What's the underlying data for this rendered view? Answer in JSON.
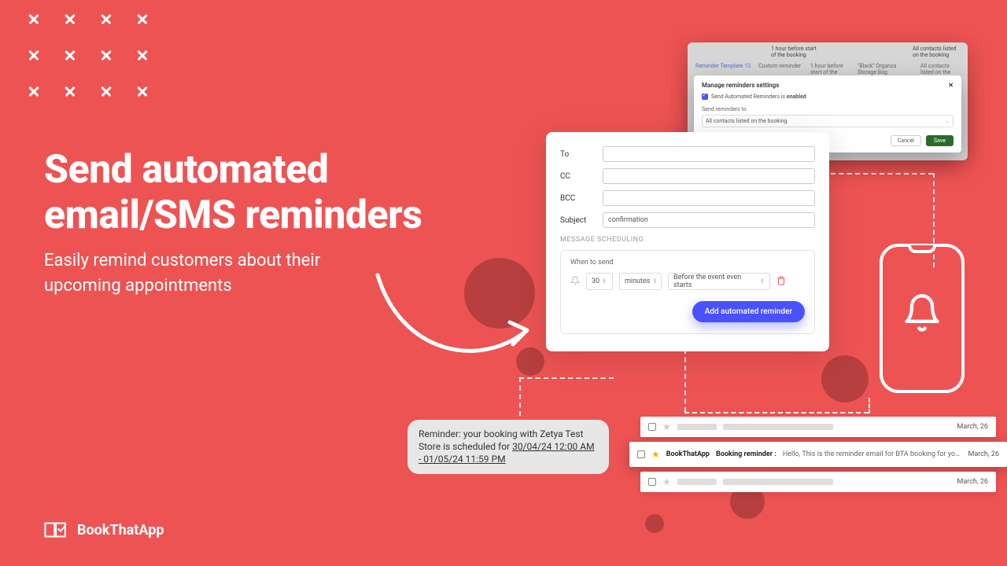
{
  "headline": "Send automated email/SMS reminders",
  "subhead": "Easily remind customers about their upcoming appointments",
  "logo_text": "BookThatApp",
  "form": {
    "to_label": "To",
    "cc_label": "CC",
    "bcc_label": "BCC",
    "subject_label": "Subject",
    "subject_value": "confirmation",
    "section_title": "MESSAGE SCHEDULING",
    "when_label": "When to send",
    "amount": "30",
    "unit": "minutes",
    "relation": "Before the event even starts",
    "add_button": "Add automated reminder"
  },
  "settings": {
    "back_tabs": {
      "a": "Reminder Template 13",
      "b": "Custom reminder"
    },
    "back_cols": {
      "c1": "1 hour before start of the booking",
      "c2": "\"Black\" Organza Storage Bag",
      "c3": "All contacts listed on the booking"
    },
    "title": "Manage reminders settings",
    "checkbox_text_pre": "Send Automated Reminders is ",
    "checkbox_text_bold": "enabled",
    "send_to_label": "Send reminders to",
    "send_to_value": "All contacts listed on the booking",
    "cancel": "Cancel",
    "save": "Save"
  },
  "sms": {
    "line1": "Reminder: your booking with Zetya Test Store is scheduled for ",
    "datetime": "30/04/24 12:00 AM - 01/05/24 11:59 PM"
  },
  "email": {
    "sender": "BookThatApp",
    "subject": "Booking reminder :",
    "preview": "Hello, This is the reminder email for BTA booking for your upcoming",
    "date": "March, 26"
  }
}
